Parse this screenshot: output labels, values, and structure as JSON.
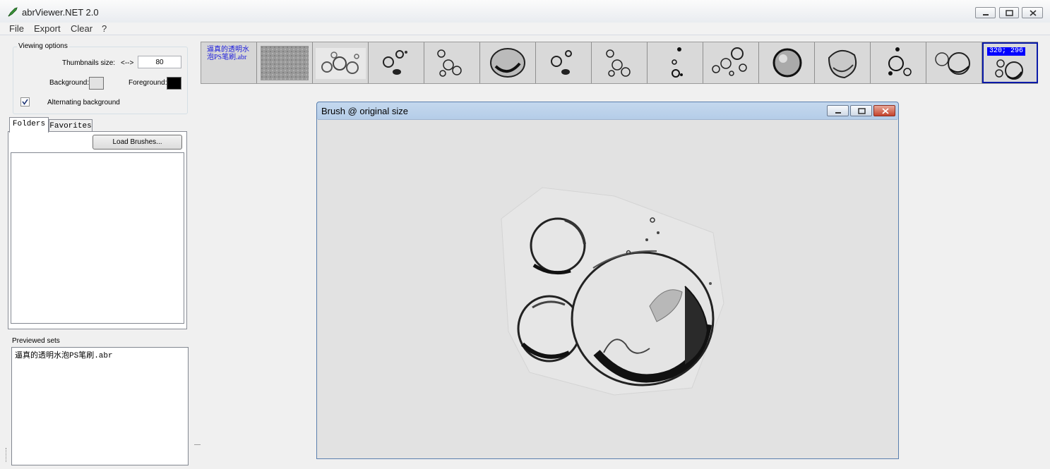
{
  "window": {
    "title": "abrViewer.NET 2.0",
    "app_icon": "pen-icon"
  },
  "menu": [
    "File",
    "Export",
    "Clear",
    "?"
  ],
  "viewing_options": {
    "group_title": "Viewing options",
    "thumb_size_label": "Thumbnails size:",
    "thumb_size_arrows": "<-->",
    "thumb_size_value": "80",
    "background_label": "Background:",
    "background_color": "#e2e2e2",
    "foreground_label": "Foreground:",
    "foreground_color": "#000000",
    "alternating_label": "Alternating background",
    "alternating_checked": true
  },
  "tabs": {
    "folders": "Folders",
    "favorites": "Favorites"
  },
  "load_button": "Load Brushes...",
  "previewed": {
    "title": "Previewed sets",
    "items": [
      "逼真的透明水泡PS笔刷.abr"
    ]
  },
  "strip": {
    "set_name": "逼真的透明水泡PS笔刷.abr",
    "selected_size": "320; 296",
    "selection_color": "#0a1aa8"
  },
  "brush_window": {
    "title": "Brush @ original size"
  }
}
